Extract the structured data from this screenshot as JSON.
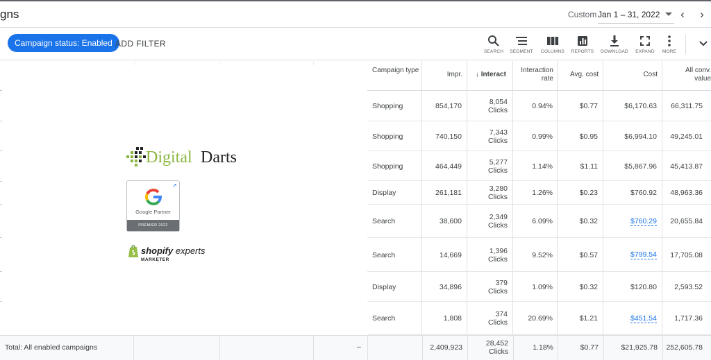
{
  "header": {
    "page_title": "gns",
    "date_label": "Custom",
    "date_range": "Jan 1 – 31, 2022"
  },
  "filters": {
    "status_chip": "Campaign status: Enabled",
    "add_filter": "ADD FILTER"
  },
  "toolbar": [
    {
      "label": "SEARCH",
      "icon": "search-icon"
    },
    {
      "label": "SEGMENT",
      "icon": "segment-icon"
    },
    {
      "label": "COLUMNS",
      "icon": "columns-icon"
    },
    {
      "label": "REPORTS",
      "icon": "reports-icon"
    },
    {
      "label": "DOWNLOAD",
      "icon": "download-icon"
    },
    {
      "label": "EXPAND",
      "icon": "expand-icon"
    },
    {
      "label": "MORE",
      "icon": "more-icon"
    }
  ],
  "overlay": {
    "logo_green": "Digital",
    "logo_dark": "Darts",
    "partner_label": "Google Partner",
    "partner_tier": "PREMIER 2022",
    "shopify_brand": "shopify",
    "shopify_suffix": "experts",
    "shopify_sub": "MARKETER"
  },
  "columns": [
    "Campaign type",
    "Impr.",
    "Interact",
    "Interaction rate",
    "Avg. cost",
    "Cost",
    "All conv. value"
  ],
  "rows": [
    {
      "type": "Shopping",
      "impr": "854,170",
      "inter": "8,054",
      "unit": "Clicks",
      "rate": "0.94%",
      "avg": "$0.77",
      "cost": "$6,170.63",
      "conv": "66,311.75",
      "link": false
    },
    {
      "type": "Shopping",
      "impr": "740,150",
      "inter": "7,343",
      "unit": "Clicks",
      "rate": "0.99%",
      "avg": "$0.95",
      "cost": "$6,994.10",
      "conv": "49,245.01",
      "link": false
    },
    {
      "type": "Shopping",
      "impr": "464,449",
      "inter": "5,277",
      "unit": "Clicks",
      "rate": "1.14%",
      "avg": "$1.11",
      "cost": "$5,867.96",
      "conv": "45,413.87",
      "link": false
    },
    {
      "type": "Display",
      "impr": "261,181",
      "inter": "3,280",
      "unit": "Clicks",
      "rate": "1.26%",
      "avg": "$0.23",
      "cost": "$760.92",
      "conv": "48,963.36",
      "link": false
    },
    {
      "type": "Search",
      "impr": "38,600",
      "inter": "2,349",
      "unit": "Clicks",
      "rate": "6.09%",
      "avg": "$0.32",
      "cost": "$760.29",
      "conv": "20,655.84",
      "link": true
    },
    {
      "type": "Search",
      "impr": "14,669",
      "inter": "1,396",
      "unit": "Clicks",
      "rate": "9.52%",
      "avg": "$0.57",
      "cost": "$799.54",
      "conv": "17,705.08",
      "link": true
    },
    {
      "type": "Display",
      "impr": "34,896",
      "inter": "379",
      "unit": "Clicks",
      "rate": "1.09%",
      "avg": "$0.32",
      "cost": "$120.80",
      "conv": "2,593.52",
      "link": false
    },
    {
      "type": "Search",
      "impr": "1,808",
      "inter": "374",
      "unit": "Clicks",
      "rate": "20.69%",
      "avg": "$1.21",
      "cost": "$451.54",
      "conv": "1,717.36",
      "link": true
    }
  ],
  "totals": {
    "label": "Total: All enabled campaigns",
    "type": "–",
    "impr": "2,409,923",
    "inter": "28,452",
    "unit": "Clicks",
    "rate": "1.18%",
    "avg": "$0.77",
    "cost": "$21,925.78",
    "conv": "252,605.78"
  },
  "colors": {
    "accent": "#1a73e8",
    "logo_green": "#8ab63f"
  }
}
